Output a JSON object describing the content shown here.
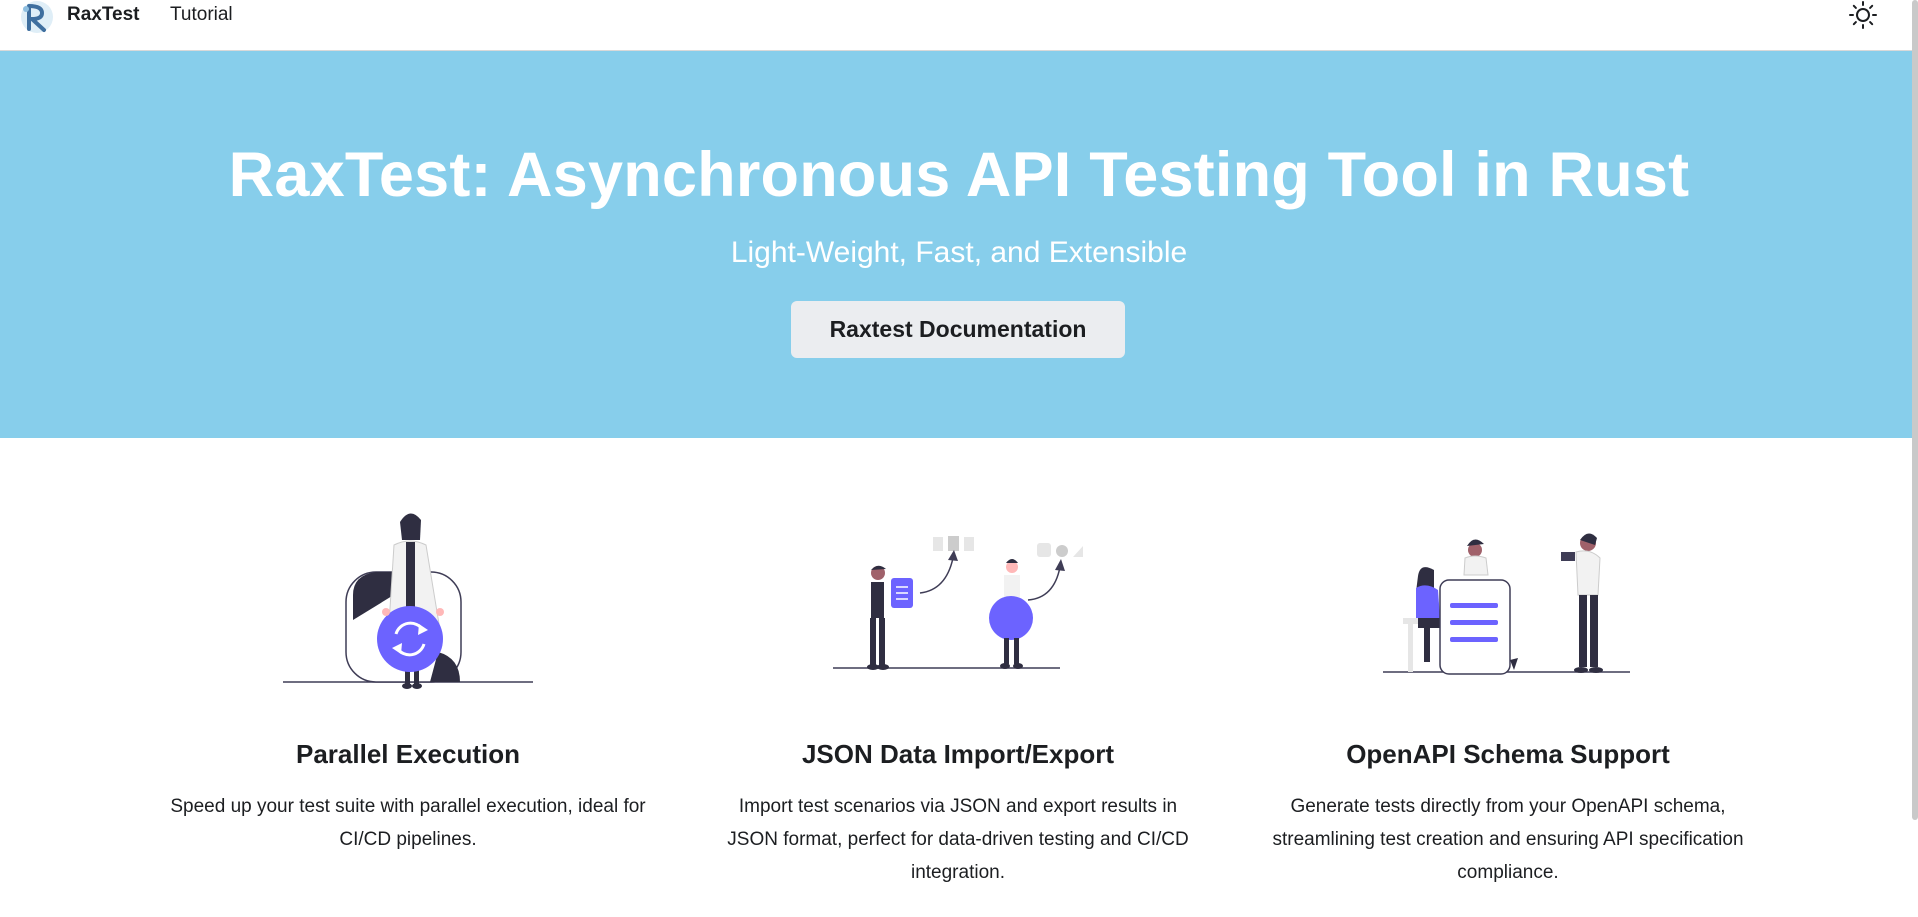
{
  "navbar": {
    "brand_title": "RaxTest",
    "links": [
      {
        "label": "Tutorial"
      }
    ],
    "logo_icon": "raxtest-logo-icon",
    "theme_icon": "sun-icon"
  },
  "hero": {
    "title": "RaxTest: Asynchronous API Testing Tool in Rust",
    "subtitle": "Light-Weight, Fast, and Extensible",
    "button_label": "Raxtest Documentation",
    "background_color": "#87ceeb"
  },
  "features": [
    {
      "title": "Parallel Execution",
      "description": "Speed up your test suite with parallel execution, ideal for CI/CD pipelines.",
      "illustration": "person-with-sync-icon-illustration"
    },
    {
      "title": "JSON Data Import/Export",
      "description": "Import test scenarios via JSON and export results in JSON format, perfect for data-driven testing and CI/CD integration.",
      "illustration": "people-exchanging-documents-illustration"
    },
    {
      "title": "OpenAPI Schema Support",
      "description": "Generate tests directly from your OpenAPI schema, streamlining test creation and ensuring API specification compliance.",
      "illustration": "team-with-document-illustration"
    }
  ],
  "colors": {
    "accent": "#6c63ff",
    "text": "#1c1e21",
    "button_bg": "#ebedf0"
  }
}
